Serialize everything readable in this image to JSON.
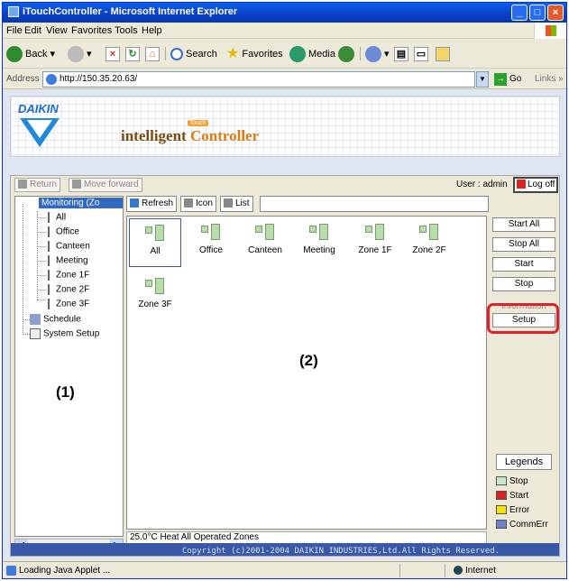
{
  "window": {
    "title": "iTouchController - Microsoft Internet Explorer"
  },
  "menu": [
    "File",
    "Edit",
    "View",
    "Favorites",
    "Tools",
    "Help"
  ],
  "toolbar": {
    "back": "Back",
    "search": "Search",
    "favorites": "Favorites",
    "media": "Media"
  },
  "address": {
    "label": "Address",
    "url": "http://150.35.20.63/",
    "go": "Go",
    "links": "Links"
  },
  "banner": {
    "brand": "DAIKIN",
    "product_a": "intelligent",
    "product_b": "Controller",
    "badge": "Touch"
  },
  "applet": {
    "return_label": "Return",
    "forward_label": "Move forward",
    "user_label": "User : admin",
    "logoff_label": "Log off",
    "refresh_label": "Refresh",
    "icon_label": "Icon",
    "list_label": "List"
  },
  "tree": {
    "root": "Monitoring (Zo",
    "zones": [
      "All",
      "Office",
      "Canteen",
      "Meeting",
      "Zone 1F",
      "Zone 2F",
      "Zone 3F"
    ],
    "schedule": "Schedule",
    "system_setup": "System Setup"
  },
  "zones": [
    "All",
    "Office",
    "Canteen",
    "Meeting",
    "Zone 1F",
    "Zone 2F",
    "Zone 3F"
  ],
  "side": {
    "start_all": "Start All",
    "stop_all": "Stop All",
    "start": "Start",
    "stop": "Stop",
    "information": "Information",
    "setup": "Setup",
    "legends": "Legends"
  },
  "legend": [
    {
      "label": "Stop",
      "color": "#c8e8c8"
    },
    {
      "label": "Start",
      "color": "#e02020"
    },
    {
      "label": "Error",
      "color": "#f5e000"
    },
    {
      "label": "CommErr",
      "color": "#7080c8"
    }
  ],
  "status_text": "25.0°C  Heat  All Operated Zones",
  "copyright": "Copyright (c)2001-2004 DAIKIN INDUSTRIES,Ltd.All Rights Reserved.",
  "callouts": {
    "one": "(1)",
    "two": "(2)"
  },
  "statusbar": {
    "left": "Loading Java Applet ...",
    "right": "Internet"
  }
}
